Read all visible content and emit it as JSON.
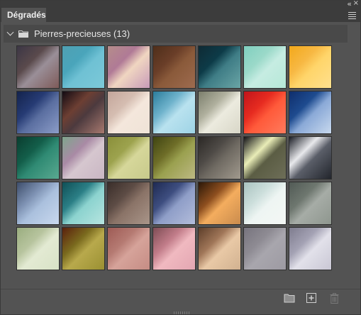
{
  "panel": {
    "tab_label": "Dégradés",
    "group_name": "Pierres-precieuses (13)"
  },
  "icons": {
    "collapse": "double-chevron-left-icon",
    "close": "close-icon",
    "menu": "hamburger-menu-icon",
    "group_toggle": "chevron-down-icon",
    "group_folder": "folder-icon",
    "new_group": "folder-icon",
    "new_gradient": "add-icon",
    "delete": "trash-icon"
  },
  "swatches": [
    [
      [
        "#3b3645",
        "#9a8f98",
        "#5a4a4c",
        "#7e5a58"
      ],
      [
        "#4fa0b3",
        "#6fc1d4",
        "#4aa5bb",
        "#7cc9d8"
      ],
      [
        "#b58d8a",
        "#f0d6c1",
        "#b07a96",
        "#c79ab8"
      ],
      [
        "#4e2e1a",
        "#8a5a3a",
        "#6a3e28",
        "#9e6b4f"
      ],
      [
        "#0f2a34",
        "#3f7d86",
        "#0d3b48",
        "#6aa5a6"
      ],
      [
        "#7fcfbf",
        "#c6ece2",
        "#9bd9c9",
        "#b6e8d8"
      ],
      [
        "#f2a81a",
        "#ffd56a",
        "#f7b843",
        "#ffe08e"
      ]
    ],
    [
      [
        "#14234c",
        "#5a6ea0",
        "#263b74",
        "#8c9dc8"
      ],
      [
        "#120b13",
        "#4c3a3e",
        "#6d3f33",
        "#a8796f"
      ],
      [
        "#c3a59a",
        "#f4e7dc",
        "#d5bdb1",
        "#efe3d7"
      ],
      [
        "#2b7c9b",
        "#b9e2ef",
        "#6fb3cc",
        "#9ed3e5"
      ],
      [
        "#7b7e6c",
        "#ecebdf",
        "#b0b09e",
        "#d8d6c7"
      ],
      [
        "#c0141b",
        "#ff5a3a",
        "#e62b20",
        "#ff7b5d"
      ],
      [
        "#0f2e6c",
        "#8aa9d7",
        "#1e4b8f",
        "#c8d9ee"
      ]
    ],
    [
      [
        "#0a3d2f",
        "#2f8a73",
        "#135e4a",
        "#5aaa91"
      ],
      [
        "#7ea68c",
        "#d6c7cf",
        "#a98aa5",
        "#c9b6c3"
      ],
      [
        "#8a8f3a",
        "#d6d79a",
        "#9da34e",
        "#c7c98b"
      ],
      [
        "#3f4412",
        "#9aa04f",
        "#6e6d28",
        "#bdb983"
      ],
      [
        "#2b2825",
        "#6f6a62",
        "#4e4a46",
        "#a19a8e"
      ],
      [
        "#121217",
        "#5b5d44",
        "#e9edb7",
        "#6e6e58"
      ],
      [
        "#1a1d25",
        "#5a5e68",
        "#e8e9ec",
        "#22252c"
      ]
    ],
    [
      [
        "#3d4d6a",
        "#aac0dd",
        "#7f93b4",
        "#c9d8ee"
      ],
      [
        "#0f4f56",
        "#8cd3cf",
        "#2b7f86",
        "#b7e5e0"
      ],
      [
        "#3a2e2a",
        "#8a7367",
        "#5d4c45",
        "#a99589"
      ],
      [
        "#1e2a52",
        "#8f9ec8",
        "#3e4e80",
        "#b3bddb"
      ],
      [
        "#2c1808",
        "#f4ad5e",
        "#8e4f1f",
        "#c98b4d"
      ],
      [
        "#a9c2c0",
        "#eef5f3",
        "#cddfdc",
        "#f4f7f4"
      ],
      [
        "#515a55",
        "#a6aca6",
        "#6e776f",
        "#8e968e"
      ]
    ],
    [
      [
        "#9aad7f",
        "#e3ead3",
        "#b7c49e",
        "#d8e2c6"
      ],
      [
        "#5a1f0d",
        "#b8a94c",
        "#7a6a1e",
        "#9a9032"
      ],
      [
        "#9e5b55",
        "#d6a39a",
        "#b57a72",
        "#c58c84"
      ],
      [
        "#7e4c54",
        "#f0b9c0",
        "#c27d8a",
        "#e3a6b2"
      ],
      [
        "#5d3e2a",
        "#e9c9a6",
        "#a07658",
        "#d1b190"
      ],
      [
        "#77747e",
        "#a8a6ad",
        "#8e8b93",
        "#9d9aa2"
      ],
      [
        "#7e7c8e",
        "#e2e1ea",
        "#a4a2b4",
        "#c9c7d4"
      ]
    ]
  ]
}
